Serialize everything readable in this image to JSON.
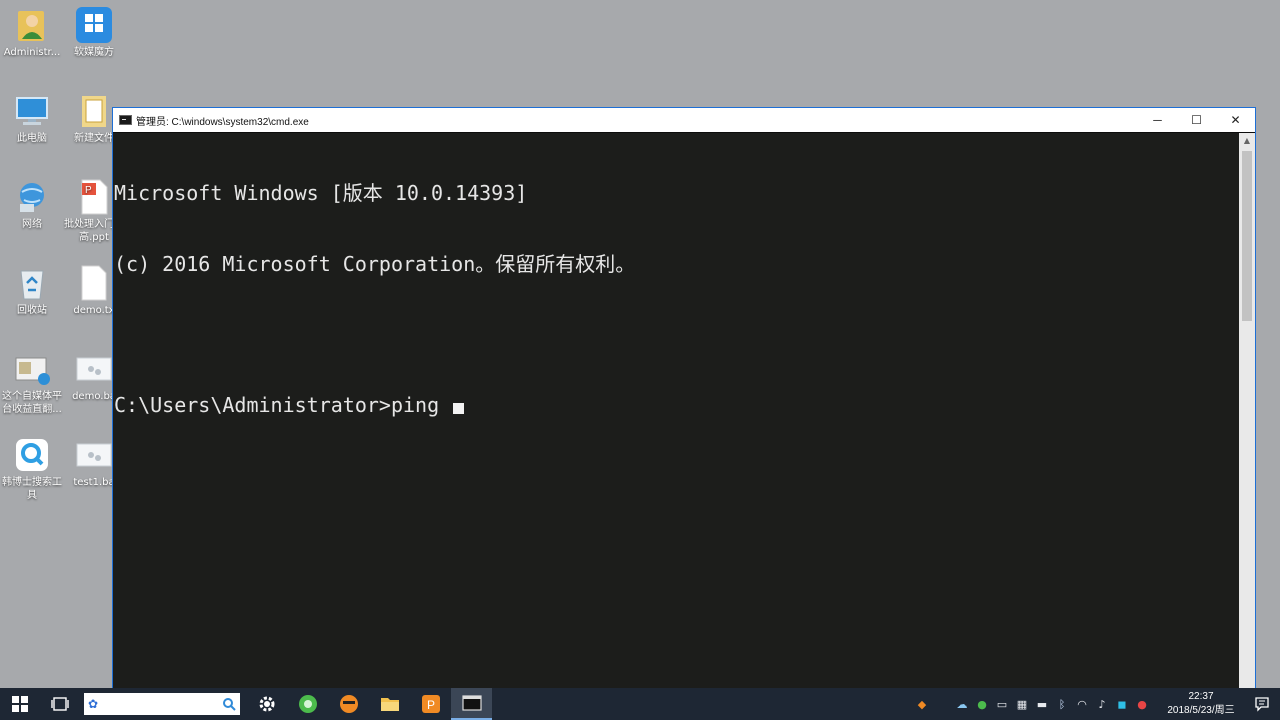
{
  "desktop": {
    "icons": [
      {
        "label": "Administr...",
        "icon": "user-folder-icon"
      },
      {
        "label": "软媒魔方",
        "icon": "app-tile-icon"
      },
      {
        "label": "此电脑",
        "icon": "computer-icon"
      },
      {
        "label": "新建文件",
        "icon": "folder-icon"
      },
      {
        "label": "网络",
        "icon": "network-icon"
      },
      {
        "label": "批处理入门提高.ppt",
        "icon": "ppt-file-icon"
      },
      {
        "label": "回收站",
        "icon": "recycle-bin-icon"
      },
      {
        "label": "demo.tx",
        "icon": "text-file-icon"
      },
      {
        "label": "这个自媒体平台收益直翻...",
        "icon": "image-file-icon"
      },
      {
        "label": "demo.ba",
        "icon": "bat-file-icon"
      },
      {
        "label": "韩博士搜索工具",
        "icon": "search-app-icon"
      },
      {
        "label": "test1.ba",
        "icon": "bat-file-icon"
      }
    ]
  },
  "cmd": {
    "title": "管理员: C:\\windows\\system32\\cmd.exe",
    "controls": {
      "minimize": "─",
      "maximize": "☐",
      "close": "✕"
    },
    "lines": [
      "Microsoft Windows [版本 10.0.14393]",
      "(c) 2016 Microsoft Corporation。保留所有权利。",
      "",
      "C:\\Users\\Administrator>ping "
    ]
  },
  "taskbar": {
    "search_placeholder": "",
    "pinned": [
      {
        "name": "settings",
        "icon": "gear-icon",
        "color": "#ffffff"
      },
      {
        "name": "browser",
        "icon": "green-browser-icon",
        "color": "#4cbb4c"
      },
      {
        "name": "game",
        "icon": "orange-face-icon",
        "color": "#f08a24"
      },
      {
        "name": "explorer",
        "icon": "folder-icon",
        "color": "#f2c14e"
      },
      {
        "name": "presentation",
        "icon": "ppt-app-icon",
        "color": "#f08a24"
      },
      {
        "name": "cmd",
        "icon": "terminal-icon",
        "color": "#ffffff",
        "active": true
      }
    ],
    "clock": {
      "time": "22:37",
      "date": "2018/5/23/周三"
    }
  }
}
